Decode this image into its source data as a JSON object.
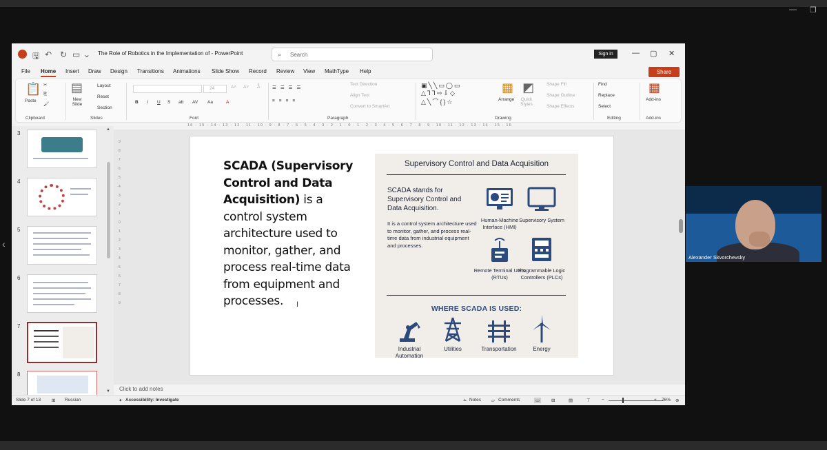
{
  "window": {
    "title": "The Role of Robotics in the Implementation of  -  PowerPoint",
    "search_placeholder": "Search",
    "sign_in": "Sign in"
  },
  "menu": {
    "items": [
      "File",
      "Home",
      "Insert",
      "Draw",
      "Design",
      "Transitions",
      "Animations",
      "Slide Show",
      "Record",
      "Review",
      "View",
      "MathType",
      "Help"
    ],
    "active": "Home",
    "share": "Share"
  },
  "ribbon": {
    "clipboard": {
      "label": "Clipboard",
      "paste": "Paste"
    },
    "slides": {
      "label": "Slides",
      "new_slide": "New Slide",
      "layout": "Layout",
      "reset": "Reset",
      "section": "Section"
    },
    "font": {
      "label": "Font",
      "size": "24"
    },
    "paragraph": {
      "label": "Paragraph",
      "text_direction": "Text Direction",
      "align_text": "Align Text",
      "convert_smartart": "Convert to SmartArt"
    },
    "drawing": {
      "label": "Drawing",
      "arrange": "Arrange",
      "quick_styles": "Quick Styles",
      "shape_fill": "Shape Fill",
      "shape_outline": "Shape Outline",
      "shape_effects": "Shape Effects"
    },
    "editing": {
      "label": "Editing",
      "find": "Find",
      "replace": "Replace",
      "select": "Select"
    },
    "addins": {
      "label": "Add-ins",
      "addins": "Add-ins"
    }
  },
  "ruler": "16 · 15 · 14 · 13 · 12 · 11 · 10 · 9 · 8 · 7 · 6 · 5 · 4 · 3 · 2 · 1 · 0 · 1 · 2 · 3 · 4 · 5 · 6 · 7 · 8 · 9 · 10 · 11 · 12 · 13 · 14 · 15 · 16",
  "thumbnails": [
    {
      "num": "3"
    },
    {
      "num": "4"
    },
    {
      "num": "5"
    },
    {
      "num": "6"
    },
    {
      "num": "7"
    },
    {
      "num": "8"
    }
  ],
  "slide": {
    "bold_text": "SCADA (Supervisory Control and Data Acquisition)",
    "text": " is a control system architecture used to monitor, gather, and process real-time data from equipment and processes."
  },
  "infographic": {
    "title": "Supervisory Control and Data Acquisition",
    "lead": "SCADA stands for Supervisory Control and Data Acquisition.",
    "desc": "It is a control system architecture used to monitor, gather, and process real-time data from industrial equipment and processes.",
    "components": [
      {
        "label": "Human-Machine Interface (HMI)",
        "icon": "hmi-monitor-icon"
      },
      {
        "label": "Supervisory System",
        "icon": "monitor-icon"
      },
      {
        "label": "Remote Terminal Units (RTUs)",
        "icon": "rtu-antenna-icon"
      },
      {
        "label": "Programmable Logic Controllers (PLCs)",
        "icon": "plc-icon"
      }
    ],
    "where_title": "WHERE SCADA IS USED:",
    "uses": [
      {
        "label": "Industrial Automation",
        "icon": "robot-arm-icon"
      },
      {
        "label": "Utilities",
        "icon": "power-tower-icon"
      },
      {
        "label": "Transportation",
        "icon": "railway-icon"
      },
      {
        "label": "Energy",
        "icon": "wind-turbine-icon"
      }
    ],
    "colors": {
      "navy": "#2c4a7c",
      "bg": "#f1eeea"
    }
  },
  "notes_placeholder": "Click to add notes",
  "status": {
    "slide": "Slide 7 of 13",
    "language": "Russian",
    "accessibility": "Accessibility: Investigate",
    "notes": "Notes",
    "comments": "Comments",
    "zoom": "76%"
  },
  "webcam": {
    "name": "Alexander Skvorchevsky"
  }
}
